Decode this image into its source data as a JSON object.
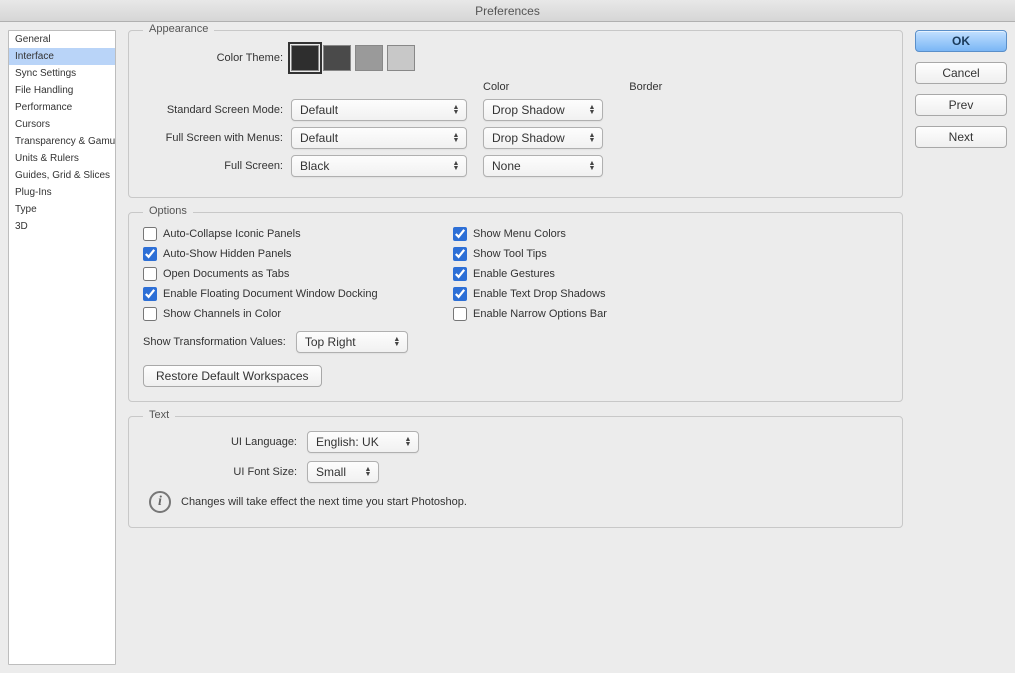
{
  "window": {
    "title": "Preferences"
  },
  "sidebar": {
    "items": [
      "General",
      "Interface",
      "Sync Settings",
      "File Handling",
      "Performance",
      "Cursors",
      "Transparency & Gamut",
      "Units & Rulers",
      "Guides, Grid & Slices",
      "Plug-Ins",
      "Type",
      "3D"
    ],
    "selected_index": 1
  },
  "buttons": {
    "ok": "OK",
    "cancel": "Cancel",
    "prev": "Prev",
    "next": "Next"
  },
  "appearance": {
    "legend": "Appearance",
    "color_theme_label": "Color Theme:",
    "swatches": [
      "#2e2e2e",
      "#4a4a4a",
      "#9a9a9a",
      "#c8c8c8"
    ],
    "selected_swatch_index": 0,
    "col_color": "Color",
    "col_border": "Border",
    "rows": [
      {
        "label": "Standard Screen Mode:",
        "color": "Default",
        "border": "Drop Shadow"
      },
      {
        "label": "Full Screen with Menus:",
        "color": "Default",
        "border": "Drop Shadow"
      },
      {
        "label": "Full Screen:",
        "color": "Black",
        "border": "None"
      }
    ]
  },
  "options": {
    "legend": "Options",
    "checks_left": [
      {
        "label": "Auto-Collapse Iconic Panels",
        "checked": false
      },
      {
        "label": "Auto-Show Hidden Panels",
        "checked": true
      },
      {
        "label": "Open Documents as Tabs",
        "checked": false
      },
      {
        "label": "Enable Floating Document Window Docking",
        "checked": true
      },
      {
        "label": "Show Channels in Color",
        "checked": false
      }
    ],
    "checks_right": [
      {
        "label": "Show Menu Colors",
        "checked": true
      },
      {
        "label": "Show Tool Tips",
        "checked": true
      },
      {
        "label": "Enable Gestures",
        "checked": true
      },
      {
        "label": "Enable Text Drop Shadows",
        "checked": true
      },
      {
        "label": "Enable Narrow Options Bar",
        "checked": false
      }
    ],
    "transform_label": "Show Transformation Values:",
    "transform_value": "Top Right",
    "restore_label": "Restore Default Workspaces"
  },
  "text": {
    "legend": "Text",
    "lang_label": "UI Language:",
    "lang_value": "English: UK",
    "font_label": "UI Font Size:",
    "font_value": "Small",
    "info": "Changes will take effect the next time you start Photoshop."
  }
}
